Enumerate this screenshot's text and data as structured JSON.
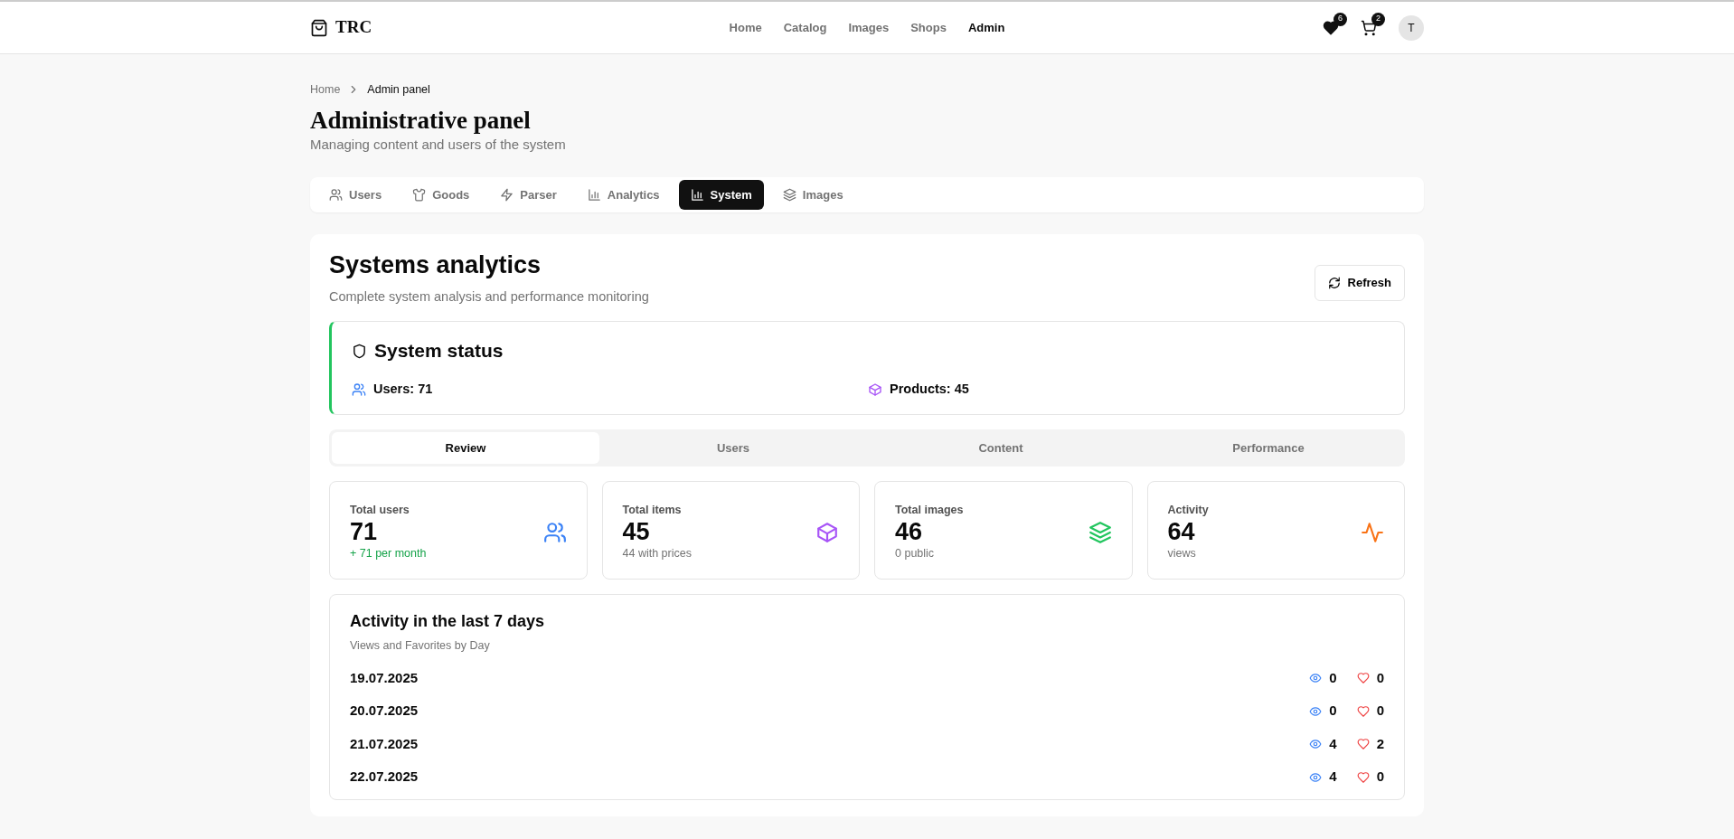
{
  "header": {
    "logo": "TRC",
    "nav": [
      {
        "label": "Home",
        "selected": false
      },
      {
        "label": "Catalog",
        "selected": false
      },
      {
        "label": "Images",
        "selected": false
      },
      {
        "label": "Shops",
        "selected": false
      },
      {
        "label": "Admin",
        "selected": true
      }
    ],
    "favorites_count": "6",
    "cart_count": "2",
    "avatar": "T"
  },
  "breadcrumb": [
    "Home",
    "Admin panel"
  ],
  "page_title": "Administrative panel",
  "page_subtitle": "Managing content and users of the system",
  "tabs": [
    {
      "label": "Users",
      "kind": "users",
      "selected": false
    },
    {
      "label": "Goods",
      "kind": "shirt",
      "selected": false
    },
    {
      "label": "Parser",
      "kind": "bolt",
      "selected": false
    },
    {
      "label": "Analytics",
      "kind": "bars",
      "selected": false
    },
    {
      "label": "System",
      "kind": "bars",
      "selected": true
    },
    {
      "label": "Images",
      "kind": "layers",
      "selected": false
    }
  ],
  "panel": {
    "title": "Systems analytics",
    "subtitle": "Complete system analysis and performance monitoring",
    "refresh_button": "Refresh"
  },
  "system_status": {
    "title": "System status",
    "items": [
      {
        "label": "Users: 71",
        "kind": "users",
        "color": "#3b82f6"
      },
      {
        "label": "Products: 45",
        "kind": "box",
        "color": "#a855f7"
      }
    ]
  },
  "subtabs": [
    {
      "label": "Review",
      "selected": true
    },
    {
      "label": "Users",
      "selected": false
    },
    {
      "label": "Content",
      "selected": false
    },
    {
      "label": "Performance",
      "selected": false
    }
  ],
  "stats": [
    {
      "label": "Total users",
      "value": "71",
      "note": "+ 71 per month",
      "positive": true,
      "kind": "users",
      "color": "#3b82f6"
    },
    {
      "label": "Total items",
      "value": "45",
      "note": "44 with prices",
      "positive": false,
      "kind": "box",
      "color": "#a855f7"
    },
    {
      "label": "Total images",
      "value": "46",
      "note": "0 public",
      "positive": false,
      "kind": "layers",
      "color": "#22c55e"
    },
    {
      "label": "Activity",
      "value": "64",
      "note": "views",
      "positive": false,
      "kind": "pulse",
      "color": "#f97316"
    }
  ],
  "activity": {
    "title": "Activity in the last 7 days",
    "subtitle": "Views and Favorites by Day",
    "rows": [
      {
        "date": "19.07.2025",
        "views": "0",
        "favorites": "0"
      },
      {
        "date": "20.07.2025",
        "views": "0",
        "favorites": "0"
      },
      {
        "date": "21.07.2025",
        "views": "4",
        "favorites": "2"
      },
      {
        "date": "22.07.2025",
        "views": "4",
        "favorites": "0"
      }
    ]
  }
}
